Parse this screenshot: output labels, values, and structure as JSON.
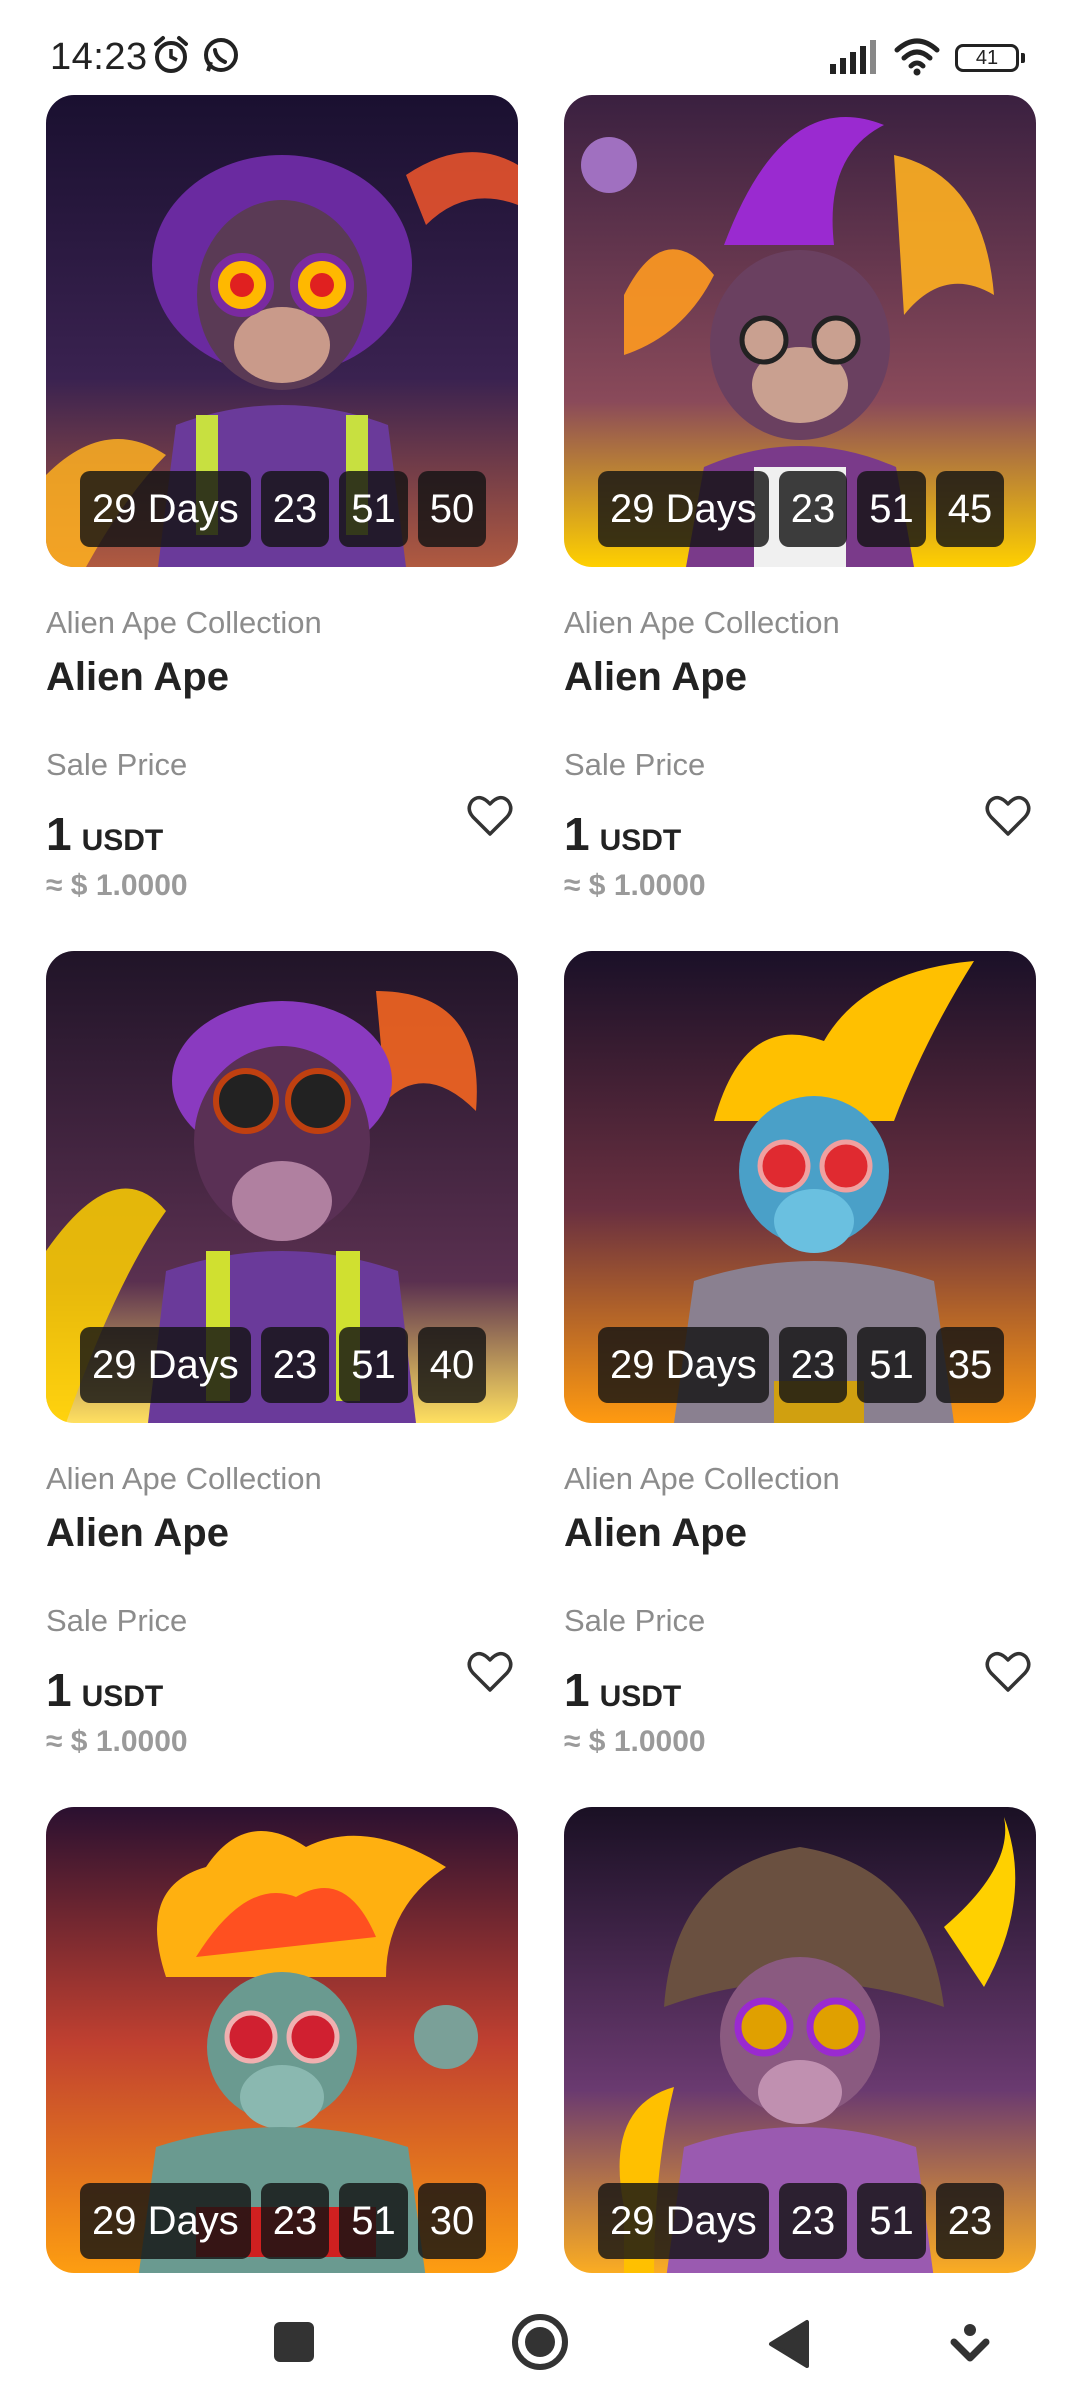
{
  "status": {
    "time": "14:23",
    "battery": "41"
  },
  "icons": {
    "alarm": "alarm-clock-icon",
    "whatsapp": "whatsapp-icon",
    "signal": "signal-icon",
    "wifi": "wifi-icon",
    "favorite": "heart-outline-icon",
    "recents": "square-icon",
    "home": "circle-icon",
    "back": "triangle-back-icon",
    "assist": "down-chevron-icon"
  },
  "colors": {
    "text": "#222222",
    "muted": "#8c8c8c",
    "timer_bg": "#141414"
  },
  "cards": [
    {
      "timer": {
        "days": "29 Days",
        "hours": "23",
        "minutes": "51",
        "seconds": "50"
      },
      "collection": "Alien Ape Collection",
      "name": "Alien Ape",
      "sale_label": "Sale Price",
      "price": "1",
      "unit": "USDT",
      "usd": "≈ $ 1.0000"
    },
    {
      "timer": {
        "days": "29 Days",
        "hours": "23",
        "minutes": "51",
        "seconds": "45"
      },
      "collection": "Alien Ape Collection",
      "name": "Alien Ape",
      "sale_label": "Sale Price",
      "price": "1",
      "unit": "USDT",
      "usd": "≈ $ 1.0000"
    },
    {
      "timer": {
        "days": "29 Days",
        "hours": "23",
        "minutes": "51",
        "seconds": "40"
      },
      "collection": "Alien Ape Collection",
      "name": "Alien Ape",
      "sale_label": "Sale Price",
      "price": "1",
      "unit": "USDT",
      "usd": "≈ $ 1.0000"
    },
    {
      "timer": {
        "days": "29 Days",
        "hours": "23",
        "minutes": "51",
        "seconds": "35"
      },
      "collection": "Alien Ape Collection",
      "name": "Alien Ape",
      "sale_label": "Sale Price",
      "price": "1",
      "unit": "USDT",
      "usd": "≈ $ 1.0000"
    },
    {
      "timer": {
        "days": "29 Days",
        "hours": "23",
        "minutes": "51",
        "seconds": "30"
      }
    },
    {
      "timer": {
        "days": "29 Days",
        "hours": "23",
        "minutes": "51",
        "seconds": "23"
      }
    }
  ]
}
